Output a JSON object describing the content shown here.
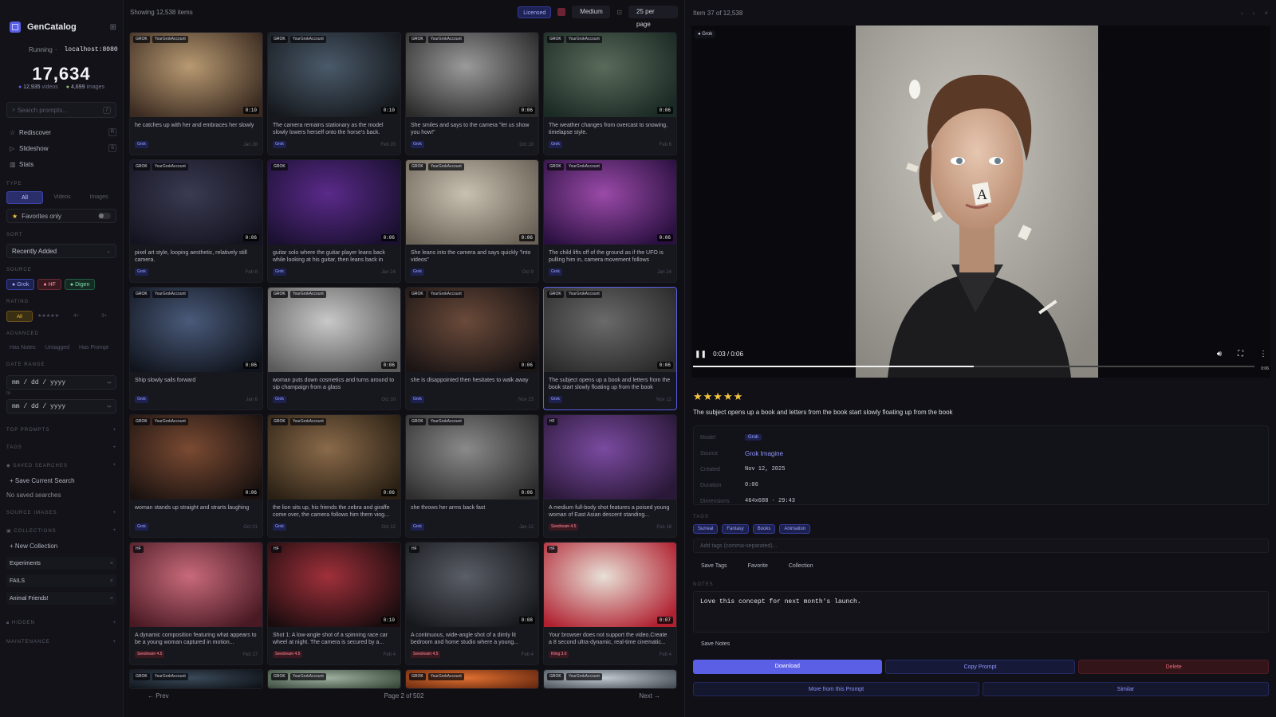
{
  "app": {
    "name": "GenCatalog",
    "status": "Running",
    "host": "localhost:8080",
    "total": "17,634",
    "videos": "12,935",
    "videos_label": "videos",
    "images": "4,699",
    "images_label": "images"
  },
  "sidebar": {
    "search_placeholder": "Search prompts…",
    "search_kbd": "/",
    "nav": [
      {
        "label": "Rediscover",
        "icon": "star-icon"
      },
      {
        "label": "Slideshow",
        "icon": "play-icon"
      },
      {
        "label": "Stats",
        "icon": "chart-icon"
      }
    ],
    "type_label": "TYPE",
    "types": [
      "All",
      "Videos",
      "Images"
    ],
    "favorites_label": "Favorites only",
    "sort_label": "SORT",
    "sort_value": "Recently Added",
    "source_label": "SOURCE",
    "sources": [
      "Grok",
      "HF",
      "Digen"
    ],
    "rating_label": "RATING",
    "ratings": [
      "All",
      "★★★★★",
      "4+",
      "3+"
    ],
    "advanced_label": "ADVANCED",
    "advanced": [
      "Has Notes",
      "Untagged",
      "Has Prompt"
    ],
    "date_label": "DATE RANGE",
    "date_from": "mm / dd / yyyy",
    "date_to_label": "to",
    "date_to": "mm / dd / yyyy",
    "top_prompts": "TOP PROMPTS",
    "tags": "TAGS",
    "saved_searches": "SAVED SEARCHES",
    "save_current": "+ Save Current Search",
    "no_saved": "No saved searches",
    "source_images": "SOURCE IMAGES",
    "collections_label": "COLLECTIONS",
    "new_collection": "+ New Collection",
    "collections": [
      "Experiments",
      "FAILS",
      "Animal Friends!"
    ],
    "hidden": "HIDDEN",
    "maintenance": "MAINTENANCE"
  },
  "grid": {
    "showing": "Showing 12,538 items",
    "licensed": "Licensed",
    "size": "Medium",
    "per_page": "25 per page",
    "prev": "← Prev",
    "page": "Page 2 of 502",
    "next": "Next →",
    "cards": [
      {
        "src": "GROK",
        "acc": "YourGrokAccount",
        "dur": "0:10",
        "cap": "he catches up with her and embraces her slowly",
        "tag": "Grok",
        "date": "Jan 28"
      },
      {
        "src": "GROK",
        "acc": "YourGrokAccount",
        "dur": "0:10",
        "cap": "The camera remains stationary as the model slowly lowers herself onto the horse's back.",
        "tag": "Grok",
        "date": "Feb 20"
      },
      {
        "src": "GROK",
        "acc": "YourGrokAccount",
        "dur": "0:06",
        "cap": "She smiles and says to the camera \"let us show you how!\"",
        "tag": "Grok",
        "date": "Oct 10"
      },
      {
        "src": "GROK",
        "acc": "YourGrokAccount",
        "dur": "0:06",
        "cap": "The weather changes from overcast to snowing, timelapse style.",
        "tag": "Grok",
        "date": "Feb 6"
      },
      {
        "src": "GROK",
        "acc": "YourGrokAccount",
        "dur": "0:06",
        "cap": "pixel art style, looping aesthetic, relatively still camera.",
        "tag": "Grok",
        "date": "Feb 8"
      },
      {
        "src": "GROK",
        "acc": "",
        "dur": "0:06",
        "cap": "guitar solo where the guitar player leans back while looking at his guitar, then leans back in",
        "tag": "Grok",
        "date": "Jan 24"
      },
      {
        "src": "GROK",
        "acc": "YourGrokAccount",
        "dur": "0:06",
        "cap": "She leans into the camera and says quickly \"into videos\"",
        "tag": "Grok",
        "date": "Oct 9"
      },
      {
        "src": "GROK",
        "acc": "YourGrokAccount",
        "dur": "0:06",
        "cap": "The child lifts off of the ground as if the UFO is pulling him in, camera movement follows",
        "tag": "Grok",
        "date": "Jan 24"
      },
      {
        "src": "GROK",
        "acc": "YourGrokAccount",
        "dur": "0:06",
        "cap": "Ship slowly sails forward",
        "tag": "Grok",
        "date": "Jan 6"
      },
      {
        "src": "GROK",
        "acc": "YourGrokAccount",
        "dur": "0:06",
        "cap": "woman puts down cosmetics and turns around to sip champaign from a glass",
        "tag": "Grok",
        "date": "Oct 10"
      },
      {
        "src": "GROK",
        "acc": "YourGrokAccount",
        "dur": "0:06",
        "cap": "she is disappointed then hesitates to walk away",
        "tag": "Grok",
        "date": "Nov 23"
      },
      {
        "src": "GROK",
        "acc": "YourGrokAccount",
        "dur": "0:06",
        "cap": "The subject opens up a book and letters from the book start slowly floating up from the book",
        "tag": "Grok",
        "date": "Nov 12"
      },
      {
        "src": "GROK",
        "acc": "YourGrokAccount",
        "dur": "0:06",
        "cap": "woman stands up straight and strarts laughing",
        "tag": "Grok",
        "date": "Oct 01"
      },
      {
        "src": "GROK",
        "acc": "YourGrokAccount",
        "dur": "0:06",
        "cap": "the lion sits up, his friends the zebra and giraffe come over, the camera follows him them viog...",
        "tag": "Grok",
        "date": "Oct 12"
      },
      {
        "src": "GROK",
        "acc": "YourGrokAccount",
        "dur": "0:06",
        "cap": "she throws her arms back fast",
        "tag": "Grok",
        "date": "Jan 12"
      },
      {
        "src": "HF",
        "acc": "",
        "dur": "",
        "cap": "A medium full-body shot features a poised young woman of East Asian descent standing...",
        "tag": "Seedream 4.5",
        "date": "Feb 18"
      },
      {
        "src": "HF",
        "acc": "",
        "dur": "",
        "cap": "A dynamic composition featuring what appears to be a young woman captured in motion...",
        "tag": "Seedream 4.5",
        "date": "Feb 17"
      },
      {
        "src": "HF",
        "acc": "",
        "dur": "0:10",
        "cap": "Shot 1: A low-angle shot of a spinning race car wheel at night. The camera is secured by a...",
        "tag": "Seedream 4.5",
        "date": "Feb 4"
      },
      {
        "src": "HF",
        "acc": "",
        "dur": "0:08",
        "cap": "A continuous, wide-angle shot of a dimly lit bedroom and home studio where a young...",
        "tag": "Seedream 4.5",
        "date": "Feb 4"
      },
      {
        "src": "HF",
        "acc": "",
        "dur": "0:07",
        "cap": "Your browser does not support the video.Create a 8 second ultra-dynamic, real-time cinematic...",
        "tag": "Kling 3.0",
        "date": "Feb 4"
      },
      {
        "src": "GROK",
        "acc": "YourGrokAccount"
      },
      {
        "src": "GROK",
        "acc": "YourGrokAccount"
      },
      {
        "src": "GROK",
        "acc": "YourGrokAccount"
      },
      {
        "src": "GROK",
        "acc": "YourGrokAccount"
      }
    ]
  },
  "detail": {
    "item_label": "Item 37 of 12,538",
    "badge": "Grok",
    "time": "0:03 / 0:06",
    "end_time": "0:06",
    "progress_fraction": 0.5,
    "rating": "★★★★★",
    "prompt": "The subject opens up a book and letters from the book start slowly floating up from the book",
    "info": [
      {
        "k": "Model",
        "v": "Grok",
        "kind": "tag"
      },
      {
        "k": "Source",
        "v": "Grok Imagine",
        "kind": "link"
      },
      {
        "k": "Created",
        "v": "Nov 12, 2025",
        "kind": "text"
      },
      {
        "k": "Duration",
        "v": "0:06",
        "kind": "text"
      },
      {
        "k": "Dimensions",
        "v": "464x688 · 29:43",
        "kind": "text"
      }
    ],
    "tags_label": "TAGS",
    "tags": [
      "Surreal",
      "Fantasy",
      "Books",
      "Animation"
    ],
    "tag_placeholder": "Add tags (comma-separated)...",
    "buttons": [
      "Save Tags",
      "Favorite",
      "Collection"
    ],
    "notes_label": "NOTES",
    "notes": "Love this concept for next month's launch.",
    "save_notes": "Save Notes",
    "download": "Download",
    "copy": "Copy Prompt",
    "delete": "Delete",
    "more": "More from this Prompt",
    "similar": "Similar"
  },
  "colors": {
    "accent": "#5b5fe6",
    "star": "#f5c542",
    "danger": "#e66b78"
  }
}
